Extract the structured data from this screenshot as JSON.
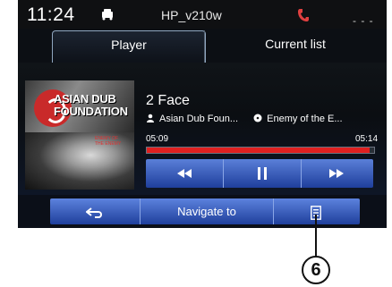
{
  "status": {
    "time": "11:24",
    "device": "HP_v210w"
  },
  "tabs": [
    {
      "label": "Player"
    },
    {
      "label": "Current list"
    }
  ],
  "album_art": {
    "line1": "ASIAN DUB",
    "line2": "FOUNDATION",
    "small": "ENEMY OF THE ENEMY"
  },
  "track": {
    "title": "2 Face",
    "artist": "Asian Dub Foun...",
    "album": "Enemy of the E...",
    "elapsed": "05:09",
    "total": "05:14",
    "progress_fraction": 0.98
  },
  "bottom": {
    "navigate_label": "Navigate to"
  },
  "callout": {
    "number": "6"
  },
  "colors": {
    "accent": "#2e56c0",
    "progress": "#e02020"
  }
}
